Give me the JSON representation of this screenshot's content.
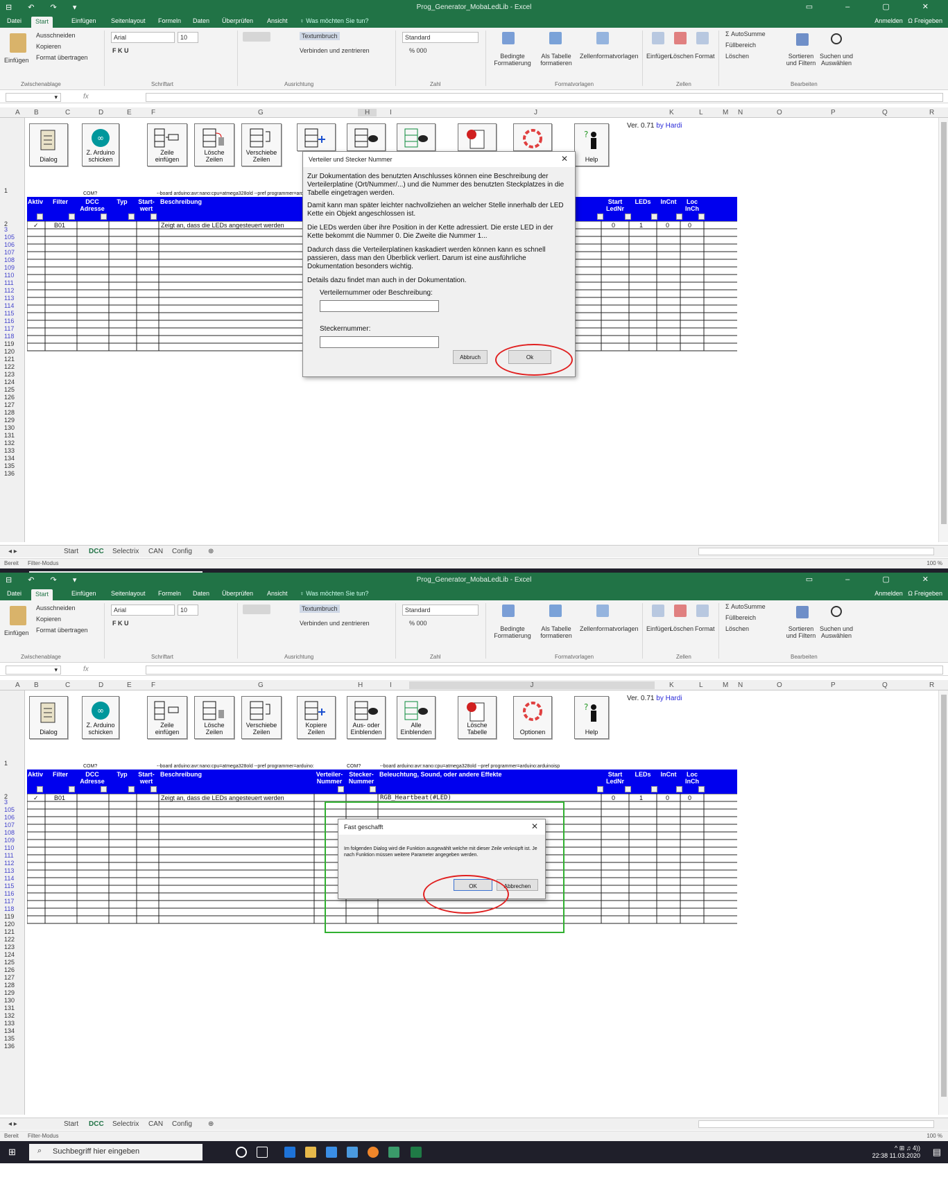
{
  "window": {
    "title": "Prog_Generator_MobaLedLib - Excel",
    "quick_access": "⊟ ↶ ↷ ▾",
    "controls": "▭ – ▢ ✕"
  },
  "menu": {
    "tabs": [
      "Datei",
      "Start",
      "Einfügen",
      "Seitenlayout",
      "Formeln",
      "Daten",
      "Überprüfen",
      "Ansicht"
    ],
    "tell_me": "♀ Was möchten Sie tun?",
    "signin": "Anmelden",
    "share": "Ω Freigeben"
  },
  "ribbon": {
    "clipboard": {
      "paste": "Einfügen",
      "cut": "Ausschneiden",
      "copy": "Kopieren",
      "format": "Format übertragen",
      "group": "Zwischenablage"
    },
    "font": {
      "name": "Arial",
      "size": "10",
      "bold_row": "F K U",
      "group": "Schriftart"
    },
    "alignment": {
      "wrap": "Textumbruch",
      "merge": "Verbinden und zentrieren",
      "group": "Ausrichtung"
    },
    "number": {
      "format": "Standard",
      "percent": "% 000",
      "group": "Zahl"
    },
    "styles": {
      "conditional": "Bedingte Formatierung",
      "table": "Als Tabelle formatieren",
      "cell": "Zellenformatvorlagen",
      "group": "Formatvorlagen"
    },
    "cells": {
      "insert": "Einfügen",
      "delete": "Löschen",
      "format": "Format",
      "group": "Zellen"
    },
    "edit": {
      "autosum": "AutoSumme",
      "fill": "Füllbereich",
      "clear": "Löschen",
      "sort": "Sortieren und Filtern",
      "find": "Suchen und Auswählen",
      "group": "Bearbeiten"
    }
  },
  "formula": {
    "fx": "fx"
  },
  "columns": [
    "A",
    "B",
    "C",
    "D",
    "E",
    "F",
    "G",
    "H",
    "I",
    "J",
    "K",
    "L",
    "M",
    "N",
    "O",
    "P",
    "Q",
    "R"
  ],
  "rows": [
    "1",
    "2",
    "3",
    "105",
    "106",
    "107",
    "108",
    "109",
    "110",
    "111",
    "112",
    "113",
    "114",
    "115",
    "116",
    "117",
    "118",
    "119",
    "120",
    "121",
    "122",
    "123",
    "124",
    "125",
    "126",
    "127",
    "128",
    "129",
    "130",
    "131",
    "132",
    "133",
    "134",
    "135",
    "136"
  ],
  "macro_buttons": [
    {
      "label": "Dialog"
    },
    {
      "label": "Z. Arduino schicken"
    },
    {
      "label": "Zeile einfügen"
    },
    {
      "label": "Lösche Zeilen"
    },
    {
      "label": "Verschiebe Zeilen"
    },
    {
      "label": "Kopiere Zeilen"
    },
    {
      "label": "Aus- oder Einblenden"
    },
    {
      "label": "Alle Einblenden"
    },
    {
      "label": "Lösche Tabelle"
    },
    {
      "label": "Optionen"
    },
    {
      "label": "Help"
    }
  ],
  "version": {
    "text": "Ver. 0.71",
    "by": "by Hardi"
  },
  "small_labels": {
    "com": "COM?",
    "board": "--board arduino:avr:nano:cpu=atmega328old --pref programmer=arduino:",
    "board2": "--board arduino:avr:nano:cpu=atmega328old --pref programmer=arduino:arduinoisp"
  },
  "table_headers": {
    "aktiv": "Aktiv",
    "filter": "Filter",
    "dcc": "DCC Adresse",
    "typ": "Typ",
    "start": "Start-wert",
    "beschreibung": "Beschreibung",
    "verteiler": "Verteiler-Nummer",
    "stecker": "Stecker-Nummer",
    "beleuchtung": "Beleuchtung, Sound, oder andere Effekte",
    "startled": "Start LedNr",
    "leds": "LEDs",
    "incnt": "InCnt",
    "loc": "Loc InCh"
  },
  "row3": {
    "check": "✓",
    "filter": "B01",
    "desc": "Zeigt an, dass die LEDs angesteuert werden",
    "effect": "RGB_Heartbeat(#LED)",
    "startled": "0",
    "leds": "1",
    "incnt": "0",
    "loc": "0"
  },
  "sheet_tabs": [
    "Start",
    "DCC",
    "Selectrix",
    "CAN",
    "Config"
  ],
  "status": {
    "ready": "Bereit",
    "mode": "Filter-Modus",
    "zoom": "100 %"
  },
  "taskbar": {
    "search": "Suchbegriff hier eingeben",
    "time": "22:38",
    "date": "11.03.2020",
    "tray": "^ ⊞ ♫ 4))"
  },
  "dialog1": {
    "title": "Verteiler und Stecker Nummer",
    "p1": "Zur Dokumentation des benutzten Anschlusses können eine Beschreibung der Verteilerplatine (Ort/Nummer/...) und die Nummer des benutzten Steckplatzes in die Tabelle eingetragen werden.",
    "p2": "Damit kann man später leichter nachvollziehen an welcher Stelle innerhalb der LED Kette ein Objekt angeschlossen ist.",
    "p3": "Die LEDs werden über ihre Position in der Kette adressiert. Die erste LED in der Kette bekommt die Nummer 0. Die Zweite die Nummer 1...",
    "p4": "Dadurch dass die Verteilerplatinen kaskadiert werden können kann es schnell passieren, dass man den Überblick verliert. Darum ist eine ausführliche Dokumentation besonders wichtig.",
    "p5": "Details dazu findet man auch in der Dokumentation.",
    "label1": "Verteilernummer oder Beschreibung:",
    "label2": "Steckernummer:",
    "cancel": "Abbruch",
    "ok": "Ok"
  },
  "dialog2": {
    "title": "Fast geschafft",
    "text": "Im folgenden Dialog wird die Funktion ausgewählt welche mit dieser Zeile verknüpft ist. Je nach Funktion müssen weitere Parameter angegeben werden.",
    "ok": "OK",
    "cancel": "Abbrechen"
  }
}
